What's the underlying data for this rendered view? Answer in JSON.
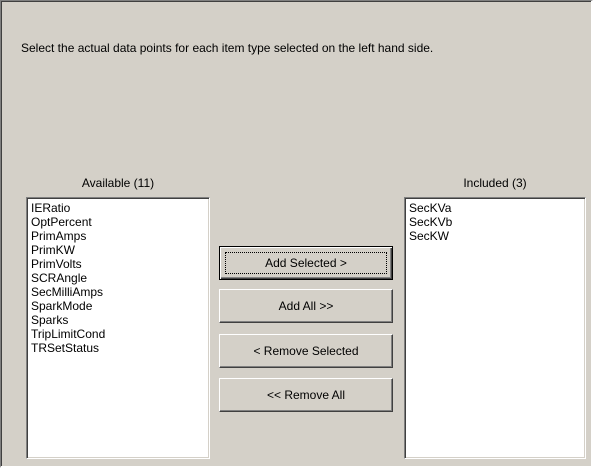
{
  "instructions": "Select the actual data points for each item type selected on the left hand side.",
  "available": {
    "label": "Available (11)",
    "items": [
      "IERatio",
      "OptPercent",
      "PrimAmps",
      "PrimKW",
      "PrimVolts",
      "SCRAngle",
      "SecMilliAmps",
      "SparkMode",
      "Sparks",
      "TripLimitCond",
      "TRSetStatus"
    ]
  },
  "included": {
    "label": "Included (3)",
    "items": [
      "SecKVa",
      "SecKVb",
      "SecKW"
    ]
  },
  "buttons": {
    "add_selected": "Add Selected >",
    "add_all": "Add All >>",
    "remove_selected": "< Remove Selected",
    "remove_all": "<< Remove All"
  }
}
